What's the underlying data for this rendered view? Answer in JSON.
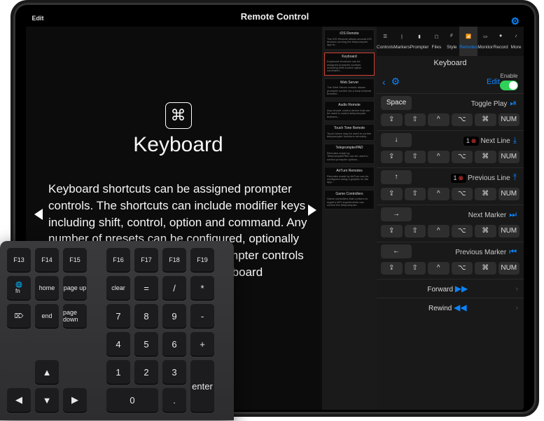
{
  "header": {
    "title": "Remote Control",
    "edit": "Edit"
  },
  "main": {
    "icon": "⌘",
    "title": "Keyboard",
    "body": "Keyboard shortcuts can be assigned prompter controls. The shortcuts can include modifier keys including shift, control, option and command. Any number of presets can be configured, optionally included as defaults, to assign prompter controls as a group. Easily print a list of keyboard shortcuts as a graphical"
  },
  "thumbs": [
    {
      "title": "iOS Remote"
    },
    {
      "title": "Keyboard"
    },
    {
      "title": "Web Server"
    },
    {
      "title": "Audio Remote"
    },
    {
      "title": "Touch Tone Remote"
    },
    {
      "title": "TeleprompterPAD"
    },
    {
      "title": "AirTurn Remotes"
    },
    {
      "title": "Game Controllers"
    }
  ],
  "toolbar": [
    {
      "label": "Controls"
    },
    {
      "label": "Markers"
    },
    {
      "label": "Prompter"
    },
    {
      "label": "Files"
    },
    {
      "label": "Style"
    },
    {
      "label": "Remotes"
    },
    {
      "label": "Monitor"
    },
    {
      "label": "Record"
    },
    {
      "label": "More"
    }
  ],
  "panel": {
    "title": "Keyboard",
    "editLink": "Edit",
    "enableLabel": "Enable",
    "mods": [
      "⇪",
      "⇧",
      "^",
      "⌥",
      "⌘",
      "NUM"
    ],
    "groups": [
      {
        "key": "Space",
        "action": "Toggle Play",
        "icon": "⏯",
        "badge": null
      },
      {
        "key": "↓",
        "action": "Next Line",
        "icon": "⤓",
        "badge": "1"
      },
      {
        "key": "↑",
        "action": "Previous Line",
        "icon": "⤒",
        "badge": "1"
      },
      {
        "key": "→",
        "action": "Next Marker",
        "icon": "⏭",
        "badge": null
      },
      {
        "key": "←",
        "action": "Previous Marker",
        "icon": "⏮",
        "badge": null
      }
    ],
    "simple": [
      {
        "action": "Forward",
        "icon": "▶▶"
      },
      {
        "action": "Rewind",
        "icon": "◀◀"
      }
    ]
  },
  "keyboard": {
    "row1": [
      "F13",
      "F14",
      "F15",
      "",
      "F16",
      "F17",
      "F18",
      "F19"
    ],
    "row2l": [
      "fn",
      "home",
      "page up"
    ],
    "row2r": [
      "clear",
      "=",
      "/",
      "*"
    ],
    "row3l": [
      "⌦",
      "end",
      "page down"
    ],
    "row3r": [
      "7",
      "8",
      "9",
      "-"
    ],
    "row4": [
      "4",
      "5",
      "6",
      "+"
    ],
    "arrows": [
      "◀",
      "▲",
      "▼",
      "▶"
    ],
    "row5": [
      "1",
      "2",
      "3"
    ],
    "row6": [
      "0",
      ".",
      "enter"
    ]
  }
}
